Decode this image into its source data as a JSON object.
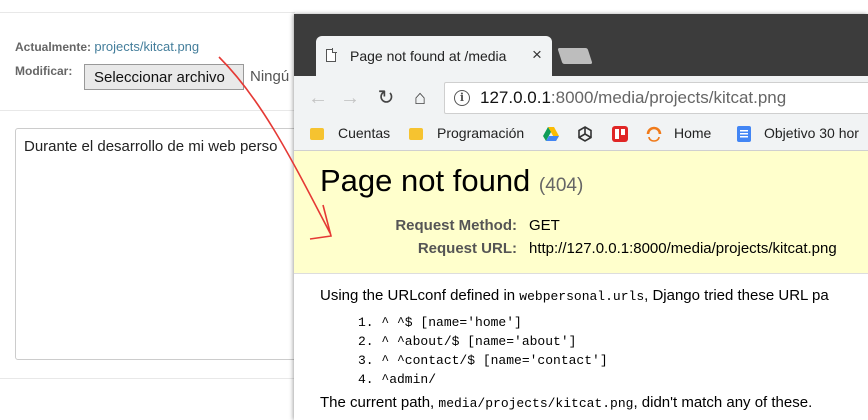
{
  "admin_form": {
    "current_label": "Actualmente:",
    "current_link": "projects/kitcat.png",
    "modify_label": "Modificar:",
    "file_button_label": "Seleccionar archivo",
    "file_status": "Ningú",
    "textarea_text": "Durante el desarrollo de mi web perso"
  },
  "browser": {
    "tab_title": "Page not found at /media",
    "tab_close": "×",
    "nav": {
      "back": "←",
      "forward": "→",
      "reload": "↻",
      "home": "⌂"
    },
    "url_host": "127.0.0.1",
    "url_rest": ":8000/media/projects/kitcat.png",
    "bookmarks": [
      {
        "label": "Cuentas",
        "icon": "folder-icon"
      },
      {
        "label": "Programación",
        "icon": "folder-icon"
      },
      {
        "label": "",
        "icon": "google-drive-icon"
      },
      {
        "label": "",
        "icon": "unity-icon"
      },
      {
        "label": "",
        "icon": "trello-icon"
      },
      {
        "label": "Home",
        "icon": "arc-logo-icon"
      },
      {
        "label": "Objetivo 30 hor",
        "icon": "docs-icon"
      }
    ]
  },
  "error_page": {
    "title": "Page not found",
    "status_code": "(404)",
    "request_method_label": "Request Method:",
    "request_method": "GET",
    "request_url_label": "Request URL:",
    "request_url": "http://127.0.0.1:8000/media/projects/kitcat.png",
    "urlconf_prefix": "Using the URLconf defined in ",
    "urlconf_module": "webpersonal.urls",
    "urlconf_suffix": ", Django tried these URL pa",
    "patterns": [
      "1. ^ ^$ [name='home']",
      "2. ^ ^about/$ [name='about']",
      "3. ^ ^contact/$ [name='contact']",
      "4. ^admin/"
    ],
    "current_prefix": "The current path, ",
    "current_path": "media/projects/kitcat.png",
    "current_suffix": ", didn't match any of these."
  },
  "colors": {
    "annotation_arrow": "#e53935",
    "admin_link": "#447e9b",
    "error_summary_bg": "#ffffcc"
  }
}
